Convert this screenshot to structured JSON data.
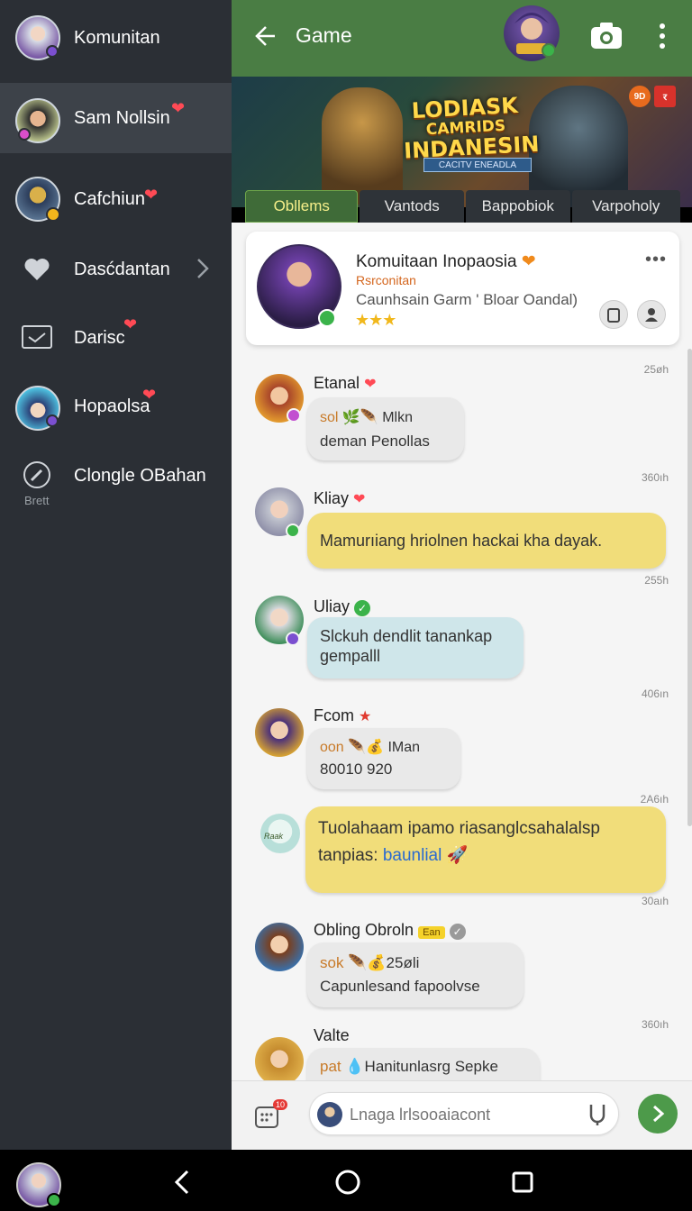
{
  "sidebar": {
    "header": {
      "label": "Komunitan"
    },
    "items": [
      {
        "label": "Sam Nollsin"
      },
      {
        "label": "Cafchiun"
      },
      {
        "label": "Dasćdantan"
      },
      {
        "label": "Darisc"
      },
      {
        "label": "Hopaolsa"
      },
      {
        "label": "Clongle OBahan",
        "icon_caption": "Brett"
      }
    ]
  },
  "topbar": {
    "title": "Game"
  },
  "banner": {
    "title_line1": "LODIASK",
    "title_line2": "CAMRIDS",
    "title_line3": "INDANESIN",
    "subtitle": "CACITV ENEADLA",
    "badge1": "9D",
    "badge2": "र"
  },
  "tabs": [
    {
      "label": "Obllems"
    },
    {
      "label": "Vantods"
    },
    {
      "label": "Bappobiok"
    },
    {
      "label": "Varpoholy"
    }
  ],
  "community": {
    "name": "Komuitaan Inopaosia",
    "sub1": "Rsrconitan",
    "sub2": "Caunhsain Garm ' Bloar Oandal)",
    "stars": "★★★"
  },
  "messages": [
    {
      "name": "Etanal",
      "time": "25øh",
      "prefix": "sol",
      "line1": "Mlkn",
      "line2": "deman Penollas"
    },
    {
      "name": "Kliay",
      "time": "360ıh",
      "text": "Mamurıiang hriolnen hackai kha dayak."
    },
    {
      "name": "Uliay",
      "time": "255h",
      "line1": "Slckuh dendlit tanankap",
      "line2": "gempalll"
    },
    {
      "name": "Fcom",
      "time": "406ın",
      "prefix": "oon",
      "line1": "IMan",
      "line2": "80010 920"
    },
    {
      "time": "2A6ıh",
      "line1": "Tuolahaam ipamo riasanglcsahalalsp",
      "line2_pre": "tanpias:",
      "line2_link": "baunlial",
      "avatar_caption": "Raak"
    },
    {
      "name": "Obling Obroln",
      "name_tag": "Ean",
      "time": "30aıh",
      "prefix": "sok",
      "line1": "25øli",
      "line2": "Capunlesand fapoolvse"
    },
    {
      "name": "Valte",
      "time": "360ıh",
      "prefix": "pat",
      "line1": "Hanitunlasrg Sepke"
    }
  ],
  "input": {
    "placeholder": "Lnaga lrlsooaiacont",
    "apps_badge": "10"
  },
  "colors": {
    "topbar": "#4a7d44",
    "sidebar": "#2b2f35",
    "send": "#4d9a4a",
    "bubble_yellow": "#f1dd7a",
    "bubble_grey": "#e9e9e9",
    "bubble_blue": "#cfe6ea"
  }
}
